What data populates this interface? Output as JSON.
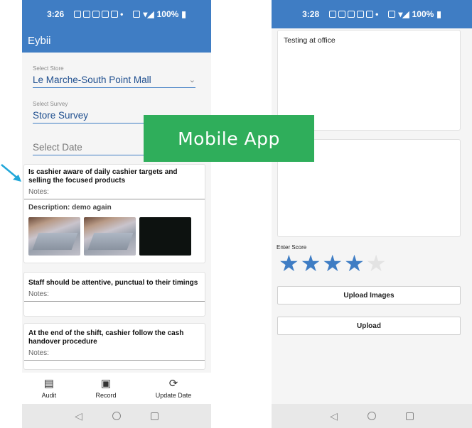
{
  "colors": {
    "primary": "#3f7dc4",
    "overlay": "#2fae5b",
    "arrow": "#21a7d9"
  },
  "left_phone": {
    "status_time": "3:26",
    "battery": "100%",
    "app_title": "Eybii",
    "store": {
      "label": "Select Store",
      "value": "Le Marche-South Point Mall"
    },
    "survey": {
      "label": "Select Survey",
      "value": "Store Survey"
    },
    "date": {
      "placeholder": "Select Date"
    },
    "questions": [
      {
        "title": "Is cashier aware of daily cashier targets and selling the focused products",
        "notes_label": "Notes:",
        "description": "Description: demo again"
      },
      {
        "title": "Staff should be attentive, punctual to their timings",
        "notes_label": "Notes:"
      },
      {
        "title": "At the end of the shift, cashier follow the cash handover procedure",
        "notes_label": "Notes:"
      }
    ],
    "nav": [
      {
        "label": "Audit",
        "icon": "audit-icon"
      },
      {
        "label": "Record",
        "icon": "image-icon"
      },
      {
        "label": "Update Date",
        "icon": "refresh-icon"
      }
    ]
  },
  "right_phone": {
    "status_time": "3:28",
    "battery": "100%",
    "text1": "Testing at office",
    "text2": "",
    "score_label": "Enter Score",
    "score": 4,
    "score_max": 5,
    "upload_images_label": "Upload Images",
    "upload_label": "Upload"
  },
  "overlay_label": "Mobile App"
}
